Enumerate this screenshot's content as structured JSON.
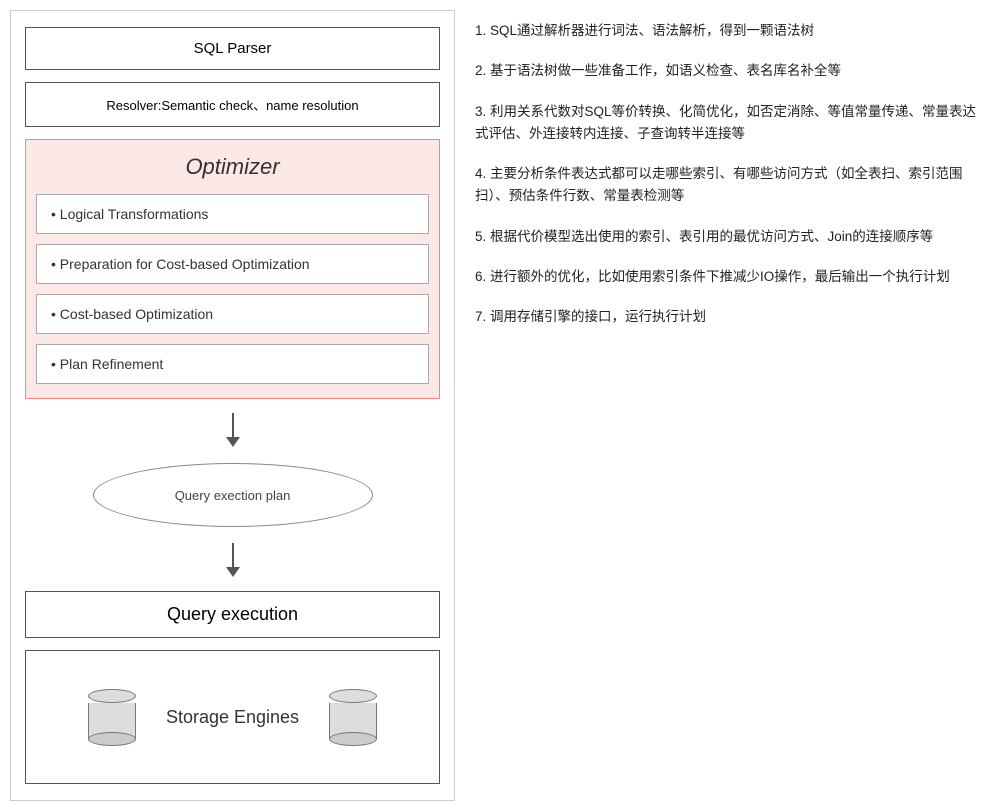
{
  "left": {
    "sql_parser": "SQL Parser",
    "resolver": "Resolver:Semantic check、name resolution",
    "optimizer": {
      "title": "Optimizer",
      "items": [
        "•  Logical Transformations",
        "•  Preparation for Cost-based Optimization",
        "•  Cost-based Optimization",
        "•  Plan Refinement"
      ]
    },
    "query_plan": "Query exection plan",
    "query_execution": "Query execution",
    "storage_engines": "Storage Engines"
  },
  "right": {
    "notes": [
      "1. SQL通过解析器进行词法、语法解析，得到一颗语法树",
      "2. 基于语法树做一些准备工作，如语义检查、表名库名补全等",
      "3. 利用关系代数对SQL等价转换、化简优化，如否定消除、等值常量传递、常量表达式评估、外连接转内连接、子查询转半连接等",
      "4. 主要分析条件表达式都可以走哪些索引、有哪些访问方式（如全表扫、索引范围扫）、预估条件行数、常量表检测等",
      "5. 根据代价模型选出使用的索引、表引用的最优访问方式、Join的连接顺序等",
      "6. 进行额外的优化，比如使用索引条件下推减少IO操作，最后输出一个执行计划",
      "7. 调用存储引擎的接口，运行执行计划"
    ]
  }
}
